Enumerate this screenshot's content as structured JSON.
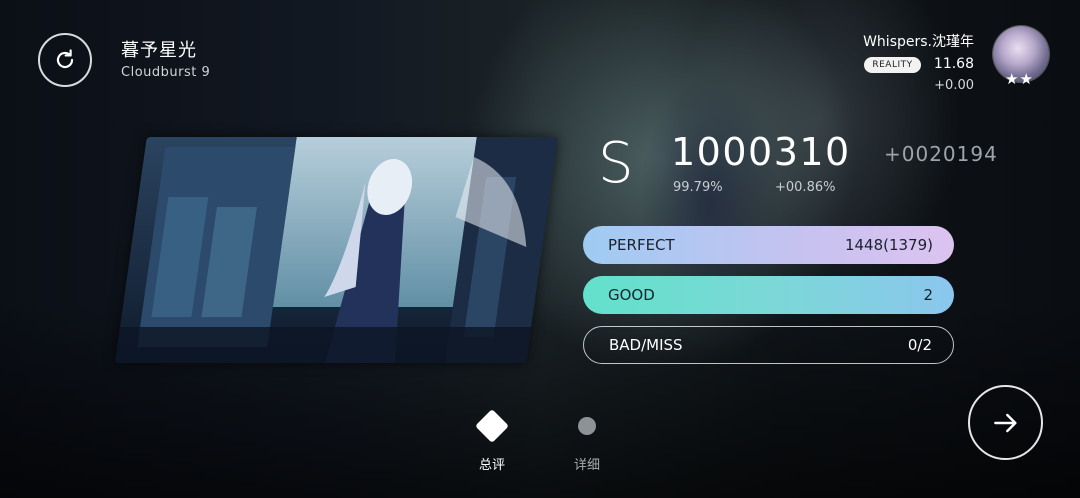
{
  "song": {
    "title": "暮予星光",
    "level": "Cloudburst 9"
  },
  "player": {
    "name": "Whispers.沈瑾年",
    "badge": "REALITY",
    "rks": "11.68",
    "rks_delta": "+0.00",
    "stars": "★★"
  },
  "result": {
    "grade": "S",
    "score": "1000310",
    "score_delta": "+0020194",
    "accuracy": "99.79%",
    "accuracy_delta": "+00.86%"
  },
  "judgements": [
    {
      "label": "PERFECT",
      "value": "1448(1379)"
    },
    {
      "label": "GOOD",
      "value": "2"
    },
    {
      "label": "BAD/MISS",
      "value": "0/2"
    }
  ],
  "tabs": {
    "overview": "总评",
    "detail": "详细"
  },
  "icons": {
    "retry": "retry-icon",
    "next": "arrow-right-icon",
    "overview": "diamond-icon",
    "detail": "dot-icon"
  },
  "colors": {
    "perfect_start": "#9fcbf2",
    "perfect_end": "#dcc3f0",
    "good_start": "#62e1cc",
    "good_end": "#8bc6ee"
  }
}
